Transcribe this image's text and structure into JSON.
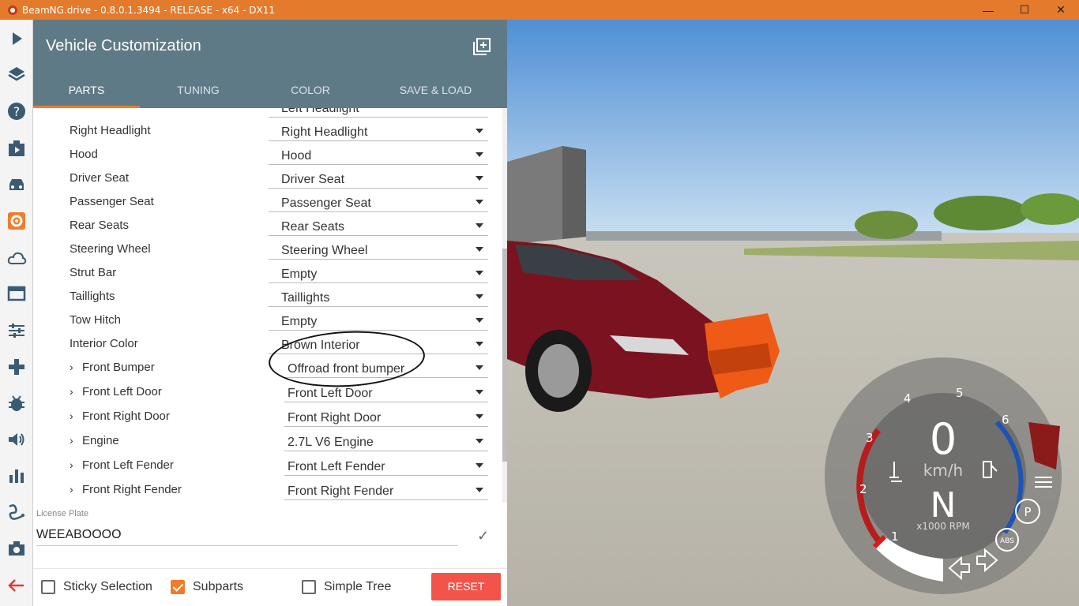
{
  "window": {
    "title": "BeamNG.drive - 0.8.0.1.3494 - RELEASE - x64 - DX11",
    "min": "—",
    "max": "☐",
    "close": "✕"
  },
  "sidebar": {
    "icons": [
      "play-icon",
      "layers-icon",
      "help-icon",
      "scenario-icon",
      "vehicle-icon",
      "gear-icon",
      "cloud-icon",
      "menu-icon",
      "tune-icon",
      "gamepad-icon",
      "bug-icon",
      "audio-icon",
      "chart-icon",
      "path-icon",
      "camera-icon",
      "back-arrow-icon"
    ]
  },
  "panel": {
    "title": "Vehicle Customization",
    "tabs": [
      "PARTS",
      "TUNING",
      "COLOR",
      "SAVE & LOAD"
    ],
    "partial_top": {
      "label": "",
      "value": "Left Headlight"
    },
    "rows": [
      {
        "label": "Right Headlight",
        "value": "Right Headlight",
        "tree": false
      },
      {
        "label": "Hood",
        "value": "Hood",
        "tree": false
      },
      {
        "label": "Driver Seat",
        "value": "Driver Seat",
        "tree": false
      },
      {
        "label": "Passenger Seat",
        "value": "Passenger Seat",
        "tree": false
      },
      {
        "label": "Rear Seats",
        "value": "Rear Seats",
        "tree": false
      },
      {
        "label": "Steering Wheel",
        "value": "Steering Wheel",
        "tree": false
      },
      {
        "label": "Strut Bar",
        "value": "Empty",
        "tree": false
      },
      {
        "label": "Taillights",
        "value": "Taillights",
        "tree": false
      },
      {
        "label": "Tow Hitch",
        "value": "Empty",
        "tree": false
      },
      {
        "label": "Interior Color",
        "value": "Brown Interior",
        "tree": false
      },
      {
        "label": "Front Bumper",
        "value": "Offroad front bumper",
        "tree": true
      },
      {
        "label": "Front Left Door",
        "value": "Front Left Door",
        "tree": true
      },
      {
        "label": "Front Right Door",
        "value": "Front Right Door",
        "tree": true
      },
      {
        "label": "Engine",
        "value": "2.7L V6 Engine",
        "tree": true
      },
      {
        "label": "Front Left Fender",
        "value": "Front Left Fender",
        "tree": true
      },
      {
        "label": "Front Right Fender",
        "value": "Front Right Fender",
        "tree": true
      }
    ],
    "license": {
      "label": "License Plate",
      "value": "WEEABOOOO"
    },
    "footer": {
      "sticky": "Sticky Selection",
      "subparts": "Subparts",
      "simple": "Simple Tree",
      "reset": "RESET"
    }
  },
  "hud": {
    "speed": "0",
    "unit": "km/h",
    "gear": "N",
    "rpm_label": "x1000 RPM",
    "ticks": [
      "1",
      "2",
      "3",
      "4",
      "5",
      "6"
    ],
    "abs": "ABS",
    "park": "P"
  },
  "colors": {
    "accent": "#f27b2a",
    "header": "#5f7a87",
    "reset": "#f2544a",
    "titlebar": "#e37a2c"
  }
}
